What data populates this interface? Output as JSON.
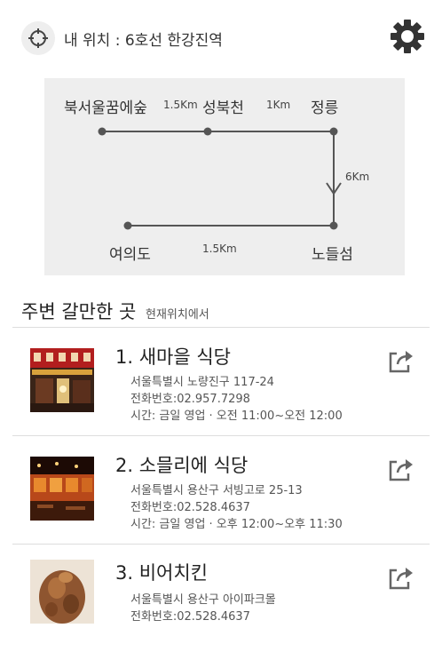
{
  "header": {
    "location_label": "내 위치 : 6호선 한강진역",
    "location_icon": "crosshair-icon",
    "settings_icon": "gear-icon"
  },
  "route": {
    "stations": {
      "start": "북서울꿈에숲",
      "second": "성북천",
      "third": "정릉",
      "fourth": "노들섬",
      "end": "여의도"
    },
    "distances": {
      "first": "1.5Km",
      "second": "1Km",
      "third": "6Km",
      "fourth": "1.5Km"
    },
    "line_color": "#555555",
    "background": "#eeeeee"
  },
  "nearby": {
    "title": "주변 갈만한 곳",
    "subtitle": "현재위치에서"
  },
  "places": [
    {
      "name": "1. 새마을 식당",
      "address": "서울특별시 노량진구 117-24",
      "phone": "전화번호:02.957.7298",
      "hours": "시간: 금일 영업 · 오전 11:00~오전 12:00",
      "share_icon": "share-icon"
    },
    {
      "name": "2. 소믈리에 식당",
      "address": "서울특별시 용산구 서빙고로 25-13",
      "phone": "전화번호:02.528.4637",
      "hours": "시간: 금일 영업 · 오후 12:00~오후 11:30",
      "share_icon": "share-icon"
    },
    {
      "name": "3. 비어치킨",
      "address": "서울특별시 용산구 아이파크몰",
      "phone": "전화번호:02.528.4637",
      "share_icon": "share-icon"
    }
  ]
}
